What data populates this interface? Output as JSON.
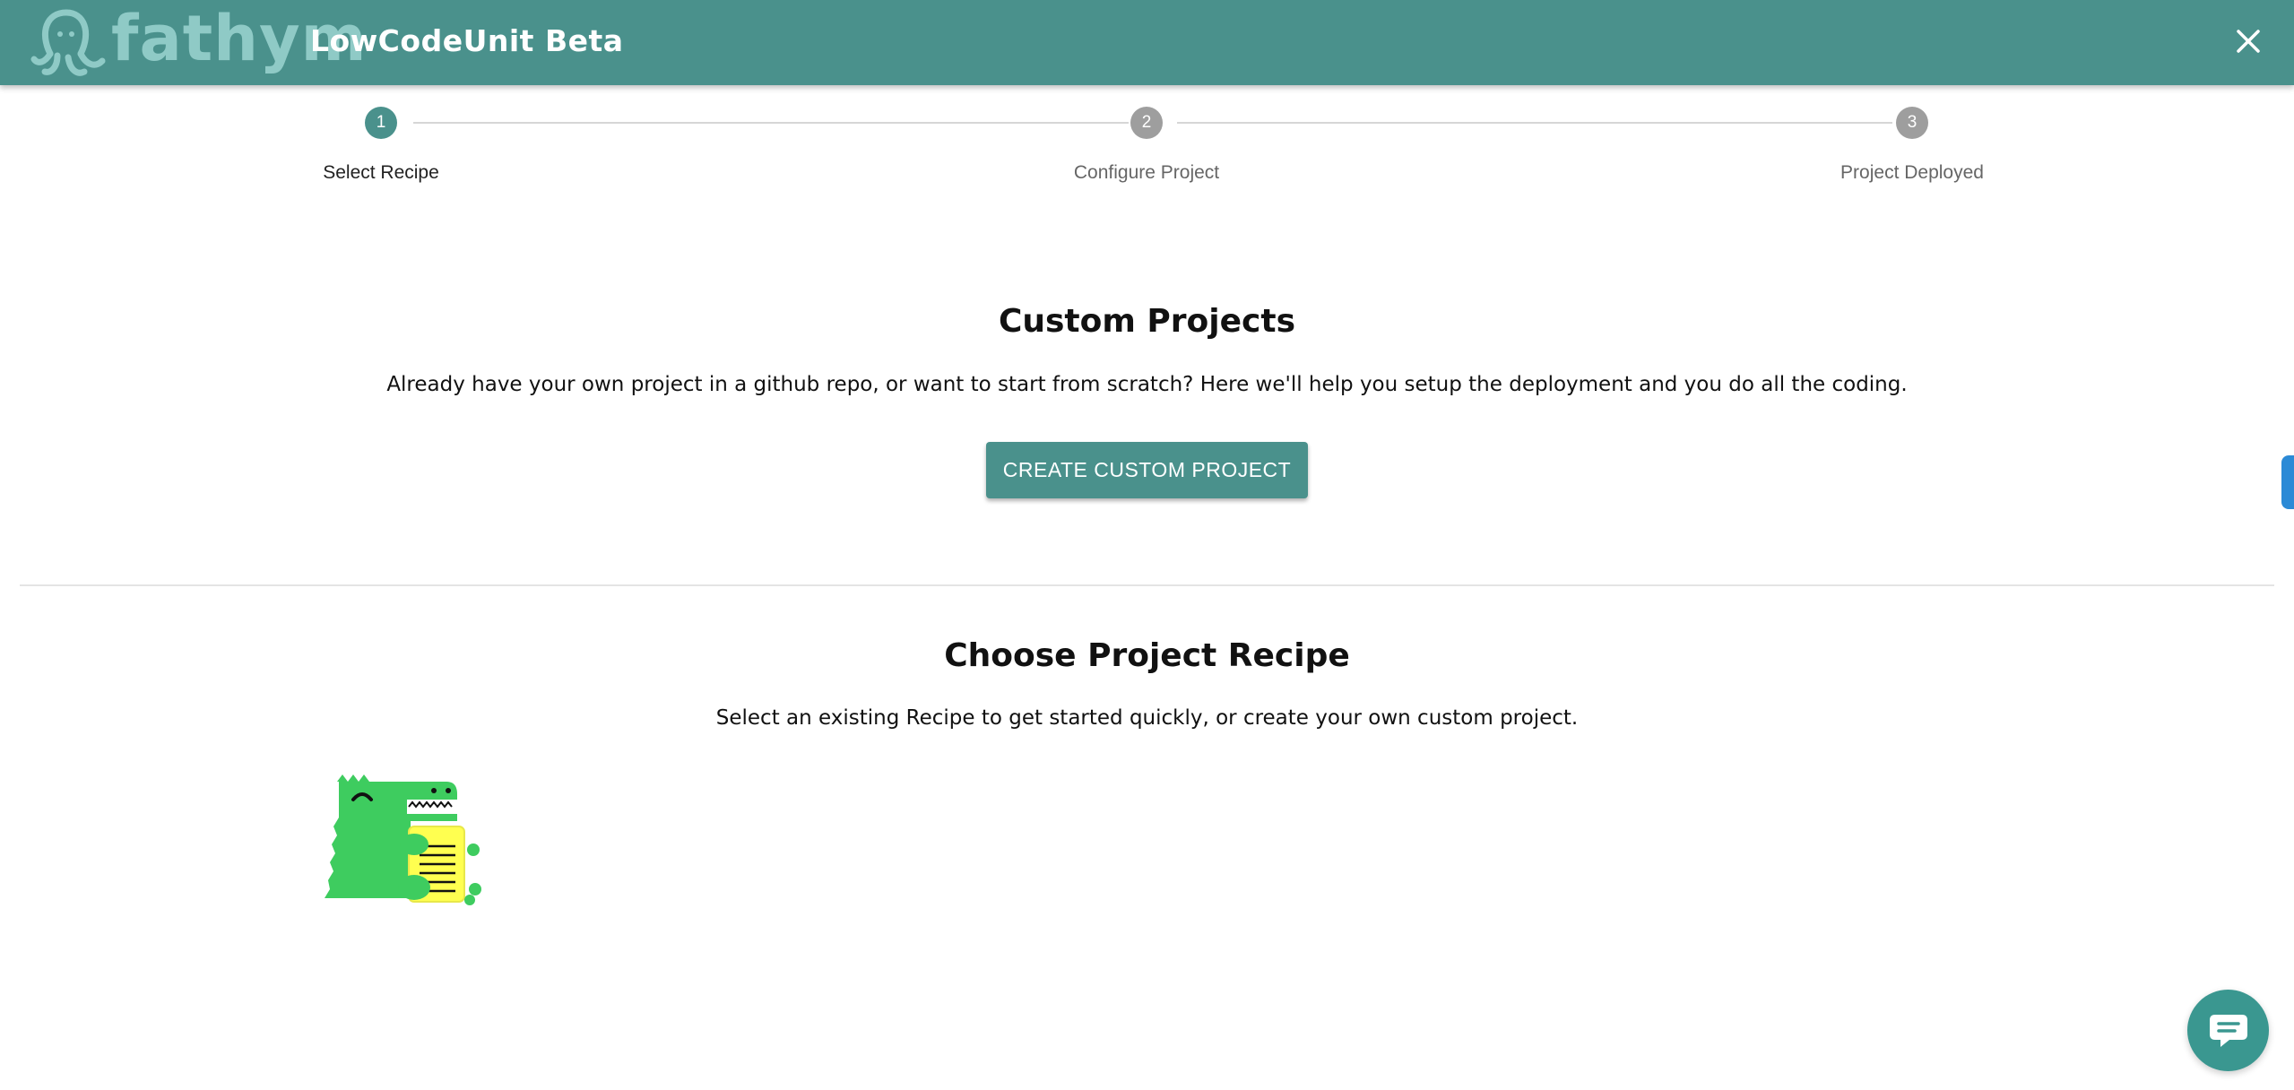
{
  "header": {
    "logo_text": "fathym",
    "app_title": "LowCodeUnit Beta",
    "close_icon": "close-icon",
    "background": "#4a918c"
  },
  "stepper": {
    "steps": [
      {
        "number": "1",
        "label": "Select Recipe",
        "active": true
      },
      {
        "number": "2",
        "label": "Configure Project",
        "active": false
      },
      {
        "number": "3",
        "label": "Project Deployed",
        "active": false
      }
    ],
    "active_color": "#4a918c",
    "inactive_color": "#9e9e9e"
  },
  "custom_projects": {
    "title": "Custom Projects",
    "description": "Already have your own project in a github repo, or want to start from scratch? Here we'll help you setup the deployment and you do all the coding.",
    "button_label": "CREATE CUSTOM PROJECT"
  },
  "recipes": {
    "title": "Choose Project Recipe",
    "description": "Select an existing Recipe to get started quickly, or create your own custom project.",
    "items": [
      {
        "icon": "docusaurus-dinosaur-icon"
      }
    ]
  },
  "chat": {
    "icon": "chat-bubble-icon"
  }
}
